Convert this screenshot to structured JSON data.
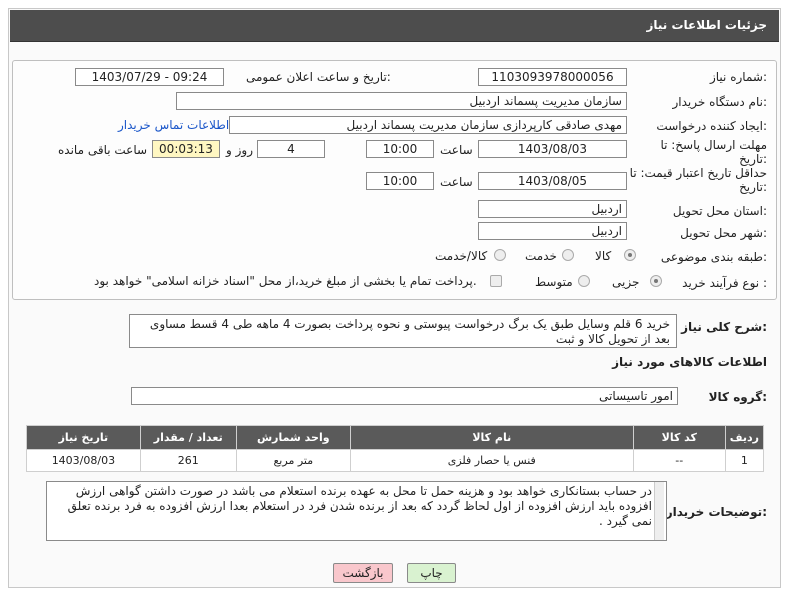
{
  "header": {
    "title": "جزئیات اطلاعات نیاز"
  },
  "form": {
    "need_number_label": "شماره نیاز:",
    "need_number": "1103093978000056",
    "announce_label": "تاریخ و ساعت اعلان عمومی:",
    "announce_value": "1403/07/29 - 09:24",
    "buyer_org_label": "نام دستگاه خریدار:",
    "buyer_org": "سازمان مدیریت پسماند اردبیل",
    "creator_label": "ایجاد کننده درخواست:",
    "creator": "مهدی صادقی کارپردازی سازمان مدیریت پسماند اردبیل",
    "contact_link": "اطلاعات تماس خریدار",
    "reply_deadline_label": "مهلت ارسال پاسخ: تا تاریخ:",
    "reply_date": "1403/08/03",
    "time_label": "ساعت",
    "reply_time": "10:00",
    "days_value": "4",
    "days_label": "روز و",
    "remaining_time": "00:03:13",
    "remaining_label": "ساعت باقی مانده",
    "price_validity_label": "حداقل تاریخ اعتبار قیمت: تا تاریخ:",
    "validity_date": "1403/08/05",
    "validity_time": "10:00",
    "province_label": "استان محل تحویل:",
    "province": "اردبیل",
    "city_label": "شهر محل تحویل:",
    "city": "اردبیل",
    "category_label": "طبقه بندی موضوعی:",
    "category_options": [
      "کالا",
      "خدمت",
      "کالا/خدمت"
    ],
    "process_label": "نوع فرآیند خرید :",
    "process_options": [
      "جزیی",
      "متوسط"
    ],
    "treasury_note": "پرداخت تمام یا بخشی از مبلغ خرید،از محل \"اسناد خزانه اسلامی\" خواهد بود."
  },
  "summary": {
    "label": "شرح کلی نیاز:",
    "text": "خرید 6 قلم وسایل طبق یک برگ درخواست پیوستی و نحوه پرداخت بصورت 4 ماهه طی 4 قسط مساوی بعد از تحویل کالا و ثبت"
  },
  "goods_info": {
    "title": "اطلاعات کالاهای مورد نیاز",
    "group_label": "گروه کالا:",
    "group_value": "امور تاسیساتی"
  },
  "table": {
    "headers": [
      "ردیف",
      "کد کالا",
      "نام کالا",
      "واحد شمارش",
      "تعداد / مقدار",
      "تاریخ نیاز"
    ],
    "rows": [
      [
        "1",
        "--",
        "فنس یا حصار فلزی",
        "متر مربع",
        "261",
        "1403/08/03"
      ]
    ]
  },
  "buyer_notes": {
    "label": "توضیحات خریدار:",
    "text": "در حساب بستانکاری خواهد بود و هزینه حمل تا محل به عهده برنده استعلام می باشد در صورت داشتن گواهی ارزش افزوده باید ارزش افزوده از اول لحاظ گردد که بعد از برنده شدن فرد در استعلام بعدا ارزش افزوده به فرد برنده تعلق نمی گیرد ."
  },
  "buttons": {
    "print": "چاپ",
    "back": "بازگشت"
  }
}
